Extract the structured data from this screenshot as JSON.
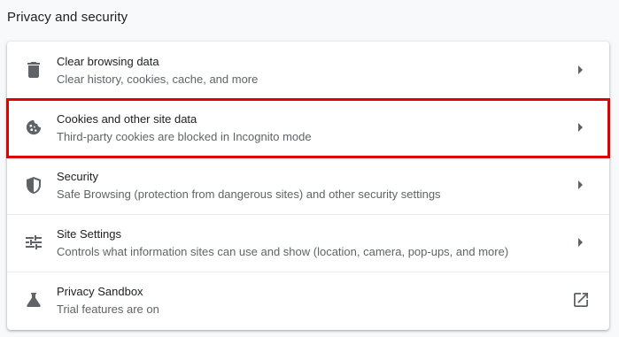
{
  "section": {
    "title": "Privacy and security"
  },
  "items": [
    {
      "label": "Clear browsing data",
      "sub": "Clear history, cookies, cache, and more",
      "icon": "trash-icon",
      "action_icon": "chevron-right-icon"
    },
    {
      "label": "Cookies and other site data",
      "sub": "Third-party cookies are blocked in Incognito mode",
      "icon": "cookie-icon",
      "action_icon": "chevron-right-icon"
    },
    {
      "label": "Security",
      "sub": "Safe Browsing (protection from dangerous sites) and other security settings",
      "icon": "shield-icon",
      "action_icon": "chevron-right-icon"
    },
    {
      "label": "Site Settings",
      "sub": "Controls what information sites can use and show (location, camera, pop-ups, and more)",
      "icon": "tune-icon",
      "action_icon": "chevron-right-icon"
    },
    {
      "label": "Privacy Sandbox",
      "sub": "Trial features are on",
      "icon": "flask-icon",
      "action_icon": "open-in-new-icon"
    }
  ],
  "colors": {
    "highlight": "#e00000",
    "icon": "#5f6368",
    "text": "#202124",
    "subtext": "#5f6368"
  }
}
